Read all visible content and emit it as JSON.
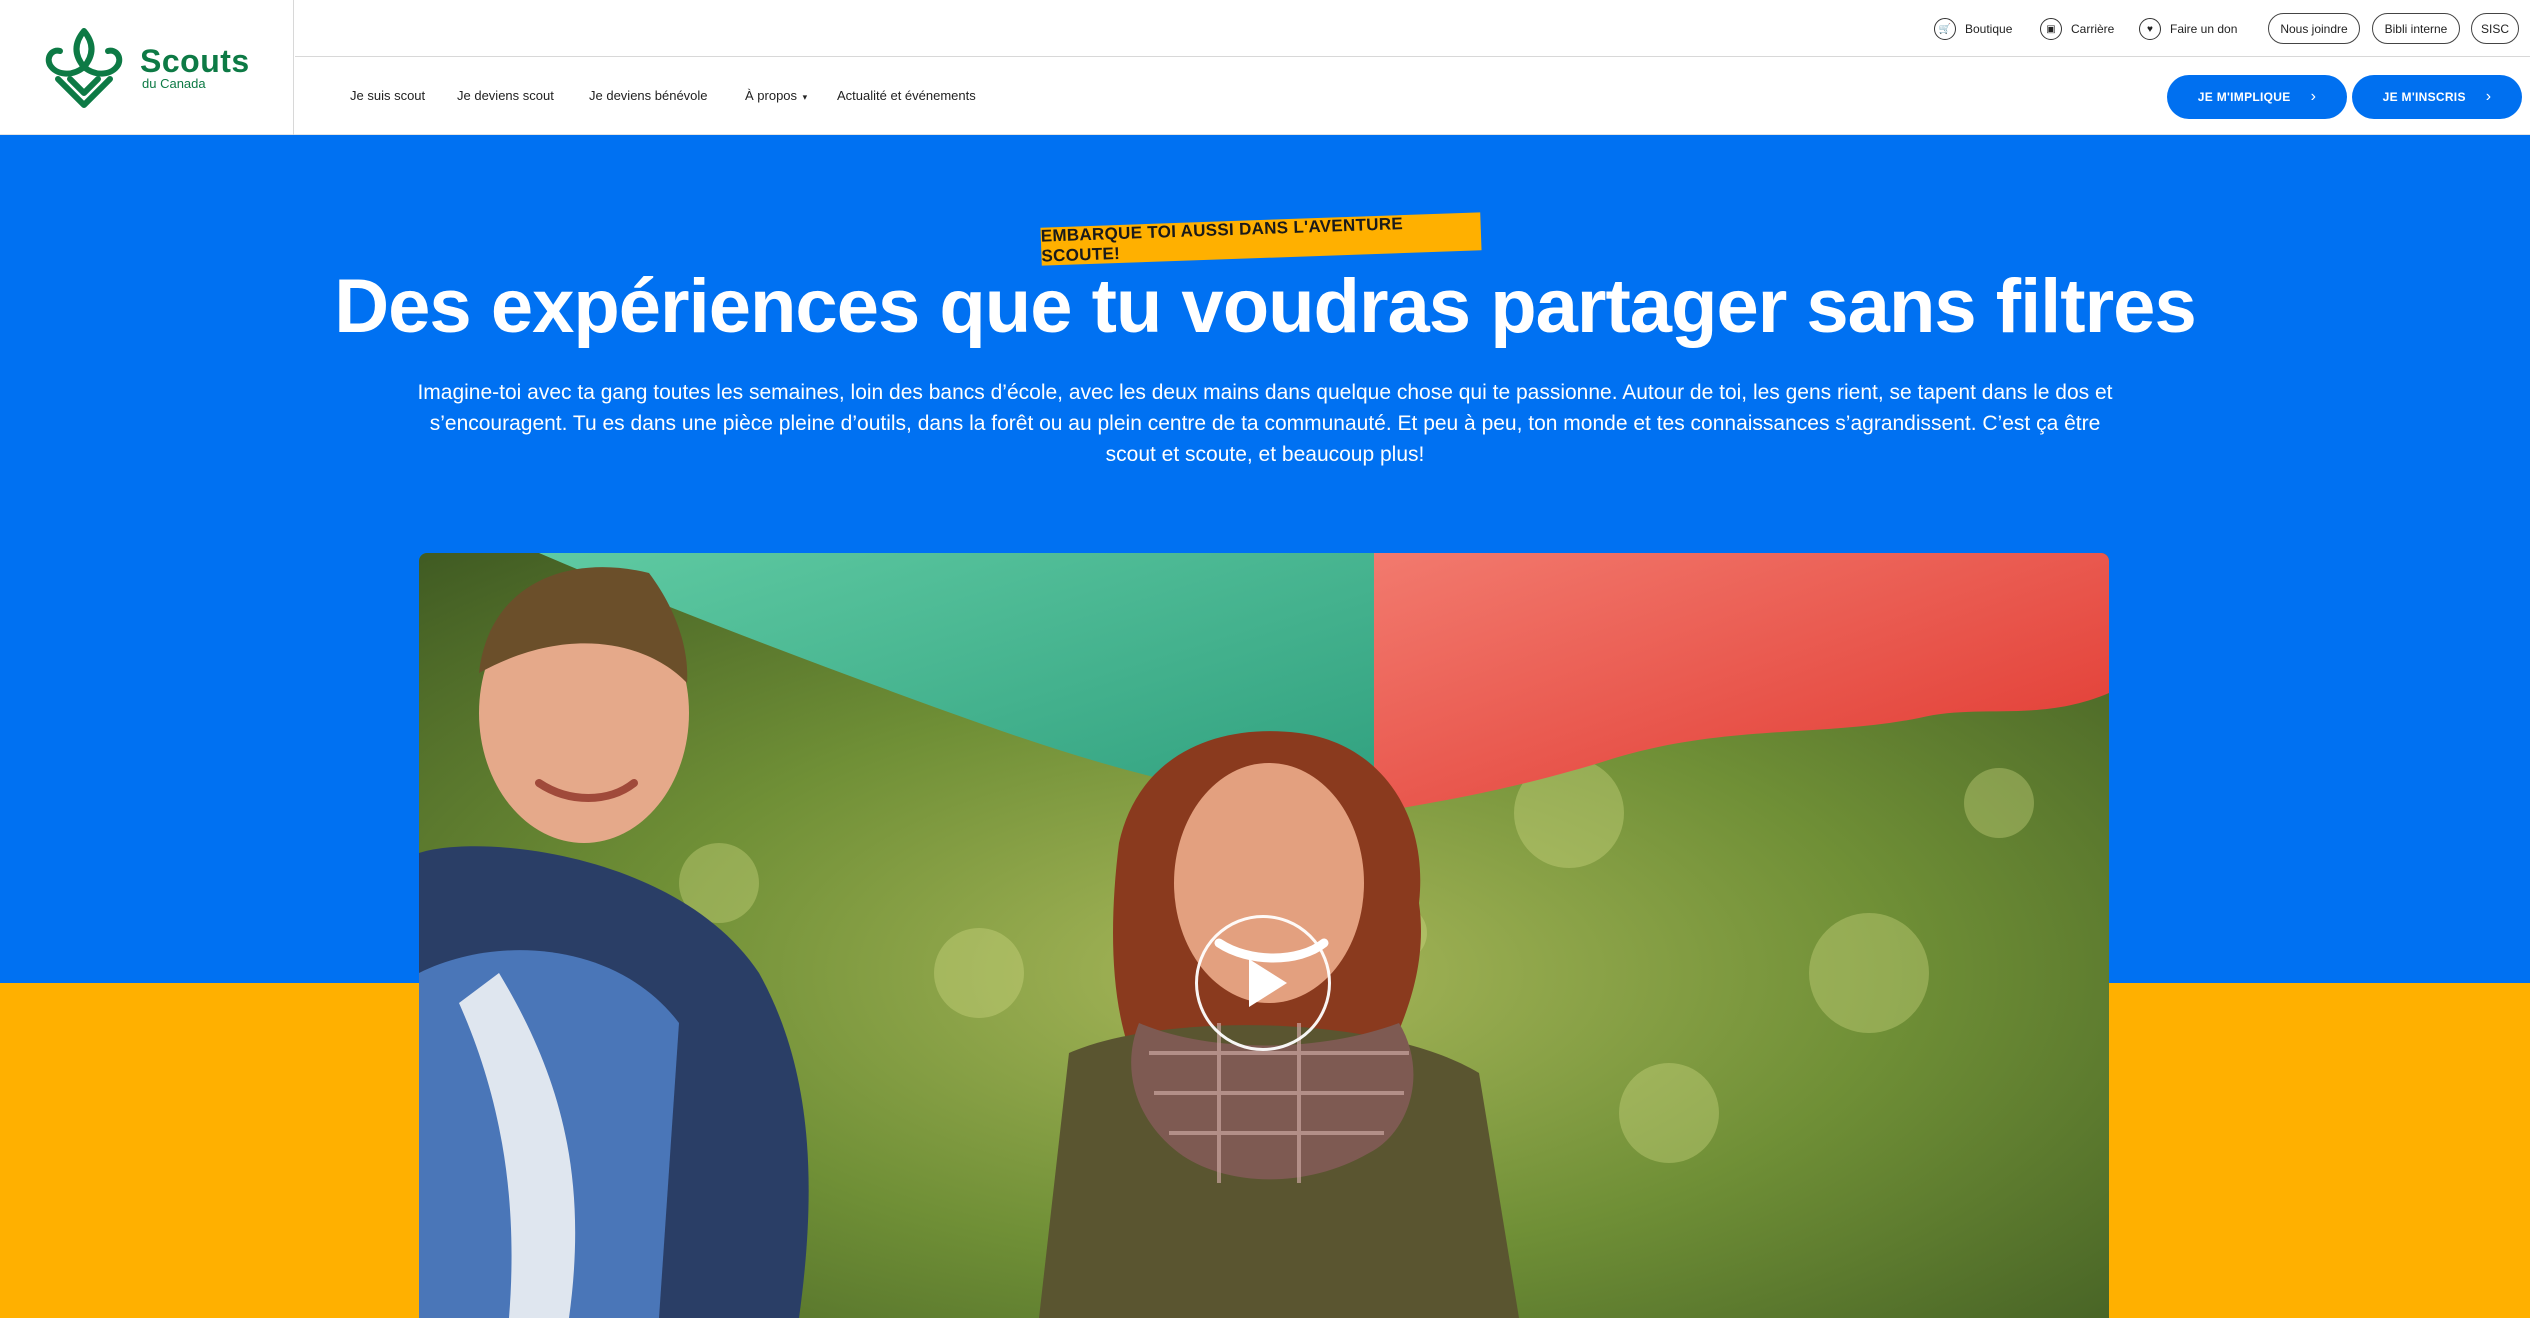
{
  "brand": {
    "name": "Scouts",
    "subtitle": "du Canada",
    "color": "#0d7a45"
  },
  "utility_nav": {
    "links": [
      {
        "label": "Boutique",
        "icon": "cart-icon"
      },
      {
        "label": "Carrière",
        "icon": "briefcase-icon"
      },
      {
        "label": "Faire un don",
        "icon": "heart-icon"
      }
    ],
    "pills": [
      "Nous joindre",
      "Bibli interne",
      "SISC"
    ]
  },
  "main_nav": {
    "items": [
      "Je suis scout",
      "Je deviens scout",
      "Je deviens bénévole",
      "À propos",
      "Actualité et événements"
    ],
    "cta_primary": "JE M'IMPLIQUE",
    "cta_secondary": "JE M'INSCRIS"
  },
  "hero": {
    "badge": "EMBARQUE TOI AUSSI DANS L'AVENTURE SCOUTE!",
    "headline": "Des expériences que tu voudras partager sans filtres",
    "lede": "Imagine-toi avec ta gang toutes les semaines, loin des bancs d’école, avec les deux mains dans quelque chose qui te passionne. Autour de toi, les gens rient, se tapent dans le dos et s’encouragent. Tu es dans une pièce pleine d’outils, dans la forêt ou au plein centre de ta communauté. Et peu à peu, ton monde et tes connaissances s’agrandissent. C’est ça être scout et scoute, et beaucoup plus!",
    "video": {
      "icon": "play-icon"
    }
  },
  "colors": {
    "hero_blue": "#0071f2",
    "accent_yellow": "#ffb000",
    "cta_blue": "#0070f0"
  }
}
